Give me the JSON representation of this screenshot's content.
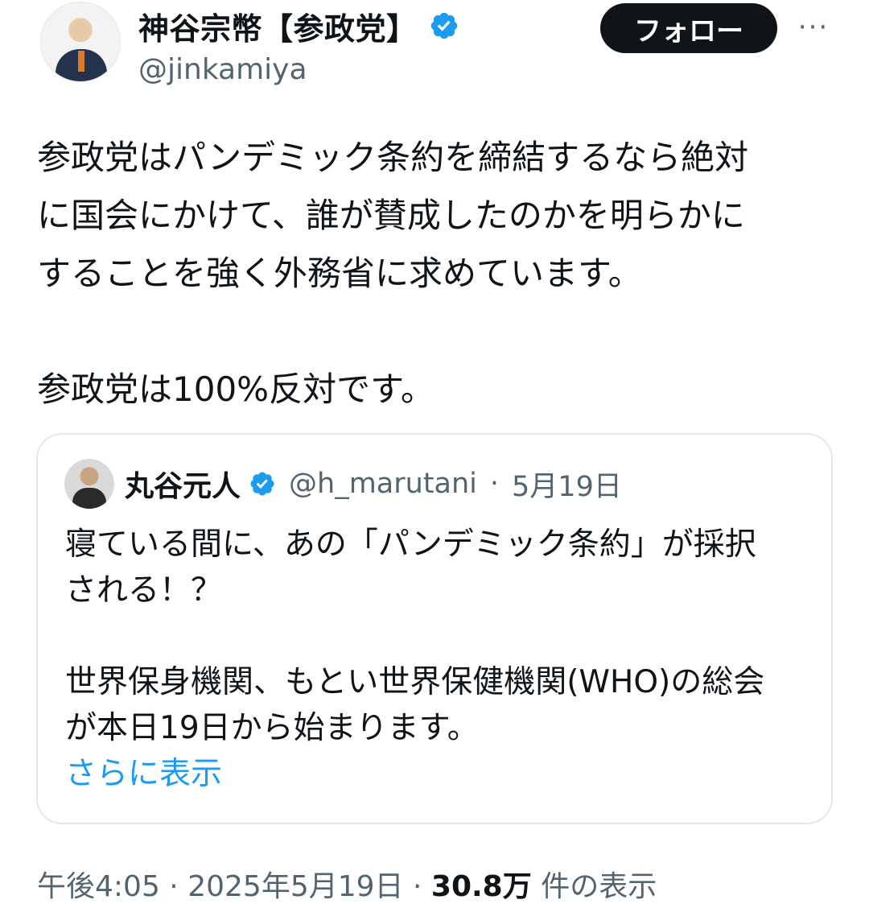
{
  "author": {
    "display_name": "神谷宗幣【参政党】",
    "handle": "@jinkamiya"
  },
  "actions": {
    "follow_label": "フォロー",
    "more_label": "···"
  },
  "tweet": {
    "lines": [
      "参政党はパンデミック条約を締結するなら絶対",
      "に国会にかけて、誰が賛成したのかを明らかに",
      "することを強く外務省に求めています。",
      "参政党は100%反対です。"
    ]
  },
  "quoted_tweet": {
    "display_name": "丸谷元人",
    "handle": "@h_marutani",
    "date": "5月19日",
    "separator": "·",
    "lines": [
      "寝ている間に、あの「パンデミック条約」が採択",
      "される！？",
      "世界保身機関、もとい世界保健機関(WHO)の総会",
      "が本日19日から始まります。"
    ],
    "show_more": "さらに表示"
  },
  "footer": {
    "time": "午後4:05",
    "date": "2025年5月19日",
    "separator": "·",
    "views_count": "30.8万",
    "views_label": "件の表示"
  },
  "colors": {
    "verified": "#1d9bf0",
    "link": "#1d9bf0",
    "muted": "#536471",
    "text": "#0f1419"
  }
}
